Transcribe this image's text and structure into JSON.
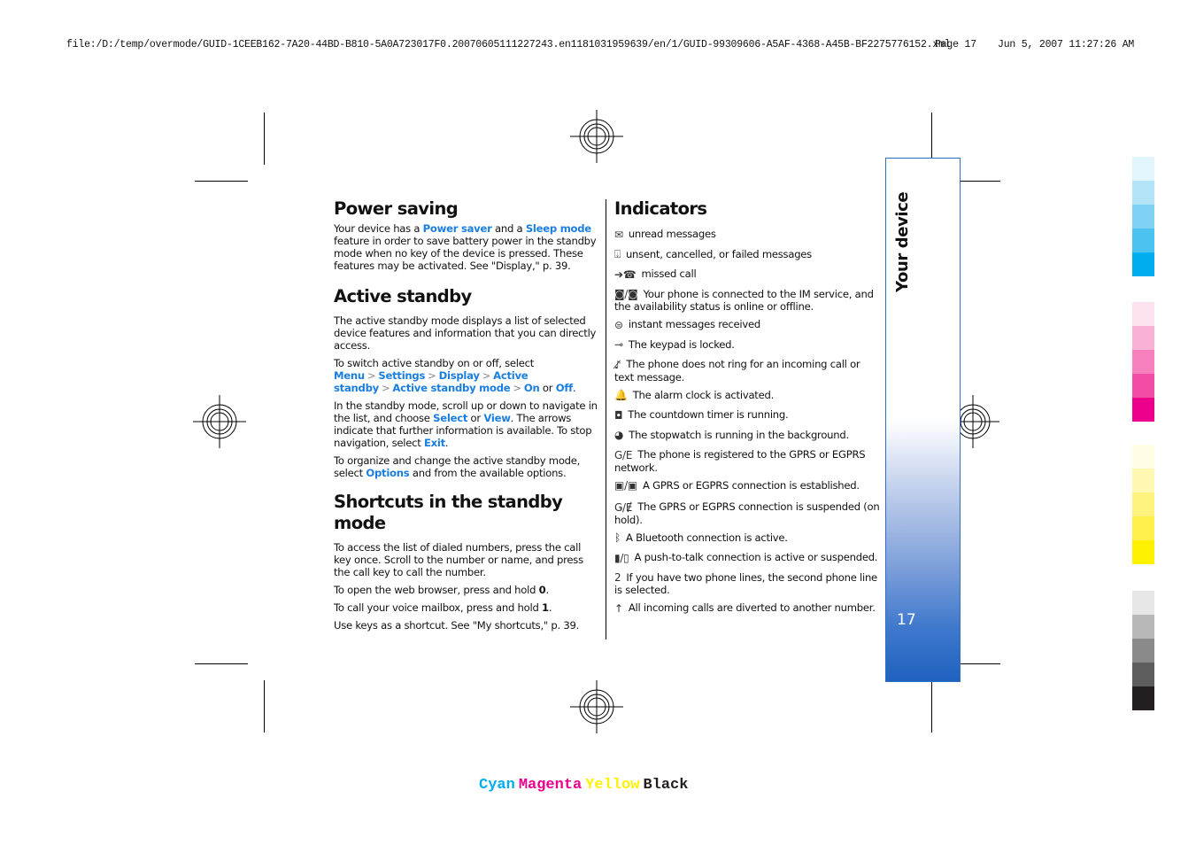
{
  "print_header": {
    "file_path": "file:/D:/temp/overmode/GUID-1CEEB162-7A20-44BD-B810-5A0A723017F0.20070605111227243.en1181031959639/en/1/GUID-99309606-A5AF-4368-A45B-BF2275776152.xml",
    "page": "Page 17",
    "datetime": "Jun 5, 2007 11:27:26 AM"
  },
  "power_saving": {
    "heading": "Power saving",
    "p1": {
      "t1": "Your device has a ",
      "link1": "Power saver",
      "t2": " and a ",
      "link2": "Sleep mode",
      "t3": " feature in order to save battery power in the standby mode when no key of the device is pressed. These features may be activated. See \"Display,\" p. 39."
    }
  },
  "active_standby": {
    "heading": "Active standby",
    "p1": "The active standby mode displays a list of selected device features and information that you can directly access.",
    "p2": {
      "t1": "To switch active standby on or off, select ",
      "path": [
        "Menu",
        "Settings",
        "Display",
        "Active standby",
        "Active standby mode"
      ],
      "on": "On",
      "or": " or ",
      "off": "Off",
      "end": "."
    },
    "p3": {
      "t1": "In the standby mode, scroll up or down to navigate in the list, and choose ",
      "select": "Select",
      "or": " or ",
      "view": "View",
      "t2": ". The arrows indicate that further information is available. To stop navigation, select ",
      "exit": "Exit",
      "end": "."
    },
    "p4": {
      "t1": "To organize and change the active standby mode, select ",
      "options": "Options",
      "t2": " and from the available options."
    }
  },
  "shortcuts": {
    "heading": "Shortcuts in the standby mode",
    "p1": "To access the list of dialed numbers, press the call key once. Scroll to the number or name, and press the call key to call the number.",
    "p2": {
      "t1": "To open the web browser, press and hold ",
      "key": "0",
      "end": "."
    },
    "p3": {
      "t1": "To call your voice mailbox, press and hold ",
      "key": "1",
      "end": "."
    },
    "p4": "Use keys as a shortcut. See \"My shortcuts,\" p. 39."
  },
  "indicators": {
    "heading": "Indicators",
    "items": [
      {
        "icon": "envelope-icon",
        "glyph": "✉",
        "text": "unread messages"
      },
      {
        "icon": "outbox-icon",
        "glyph": "⍗",
        "text": "unsent, cancelled, or failed messages"
      },
      {
        "icon": "missed-call-icon",
        "glyph": "➔☎",
        "text": "missed call"
      },
      {
        "icon": "im-connected-icon",
        "glyph": "◙/◙",
        "text": "Your phone is connected to the IM service, and the availability status is online or offline."
      },
      {
        "icon": "instant-message-icon",
        "glyph": "⊜",
        "text": "instant messages received"
      },
      {
        "icon": "keypad-lock-icon",
        "glyph": "⊸",
        "text": "The keypad is locked."
      },
      {
        "icon": "silent-icon",
        "glyph": "♪̸",
        "text": "The phone does not ring for an incoming call or text message."
      },
      {
        "icon": "alarm-bell-icon",
        "glyph": "🔔",
        "text": "The alarm clock is activated."
      },
      {
        "icon": "countdown-timer-icon",
        "glyph": "◘",
        "text": "The countdown timer is running."
      },
      {
        "icon": "stopwatch-icon",
        "glyph": "◕",
        "text": "The stopwatch is running in the background."
      },
      {
        "icon": "gprs-registered-icon",
        "glyph": "G/E",
        "text": "The phone is registered to the GPRS or EGPRS network."
      },
      {
        "icon": "gprs-connected-icon",
        "glyph": "▣/▣",
        "text": "A GPRS or EGPRS connection is established."
      },
      {
        "icon": "gprs-suspended-icon",
        "glyph": "Ǥ/Ɇ",
        "text": "The GPRS or EGPRS connection is suspended (on hold)."
      },
      {
        "icon": "bluetooth-icon",
        "glyph": "ᛒ",
        "text": "A Bluetooth connection is active."
      },
      {
        "icon": "push-to-talk-icon",
        "glyph": "▮/▯",
        "text": "A push-to-talk connection is active or suspended."
      },
      {
        "icon": "second-line-icon",
        "glyph": "2",
        "text": "If you have two phone lines, the second phone line is selected."
      },
      {
        "icon": "call-divert-icon",
        "glyph": "↑",
        "text": "All incoming calls are diverted to another number."
      }
    ]
  },
  "side_tab": {
    "title": "Your device",
    "page_number": "17",
    "color": "#1f62bf"
  },
  "color_bars": {
    "cyan": [
      "#e3f5fc",
      "#b2e3f7",
      "#80d2f4",
      "#4cc2f0",
      "#00aeef"
    ],
    "magenta": [
      "#fde3f0",
      "#f9b1d6",
      "#f580bd",
      "#f24da5",
      "#ec008c"
    ],
    "yellow": [
      "#fffde3",
      "#fff8b2",
      "#fff380",
      "#ffef4c",
      "#fff200"
    ],
    "black": [
      "#e6e6e6",
      "#b8b8b8",
      "#8a8a8a",
      "#5e5e5e",
      "#231f20"
    ]
  },
  "cmyk_labels": [
    {
      "text": "Cyan",
      "color": "#00aeef"
    },
    {
      "text": "Magenta",
      "color": "#ec008c"
    },
    {
      "text": "Yellow",
      "color": "#fff200"
    },
    {
      "text": "Black",
      "color": "#231f20"
    }
  ]
}
